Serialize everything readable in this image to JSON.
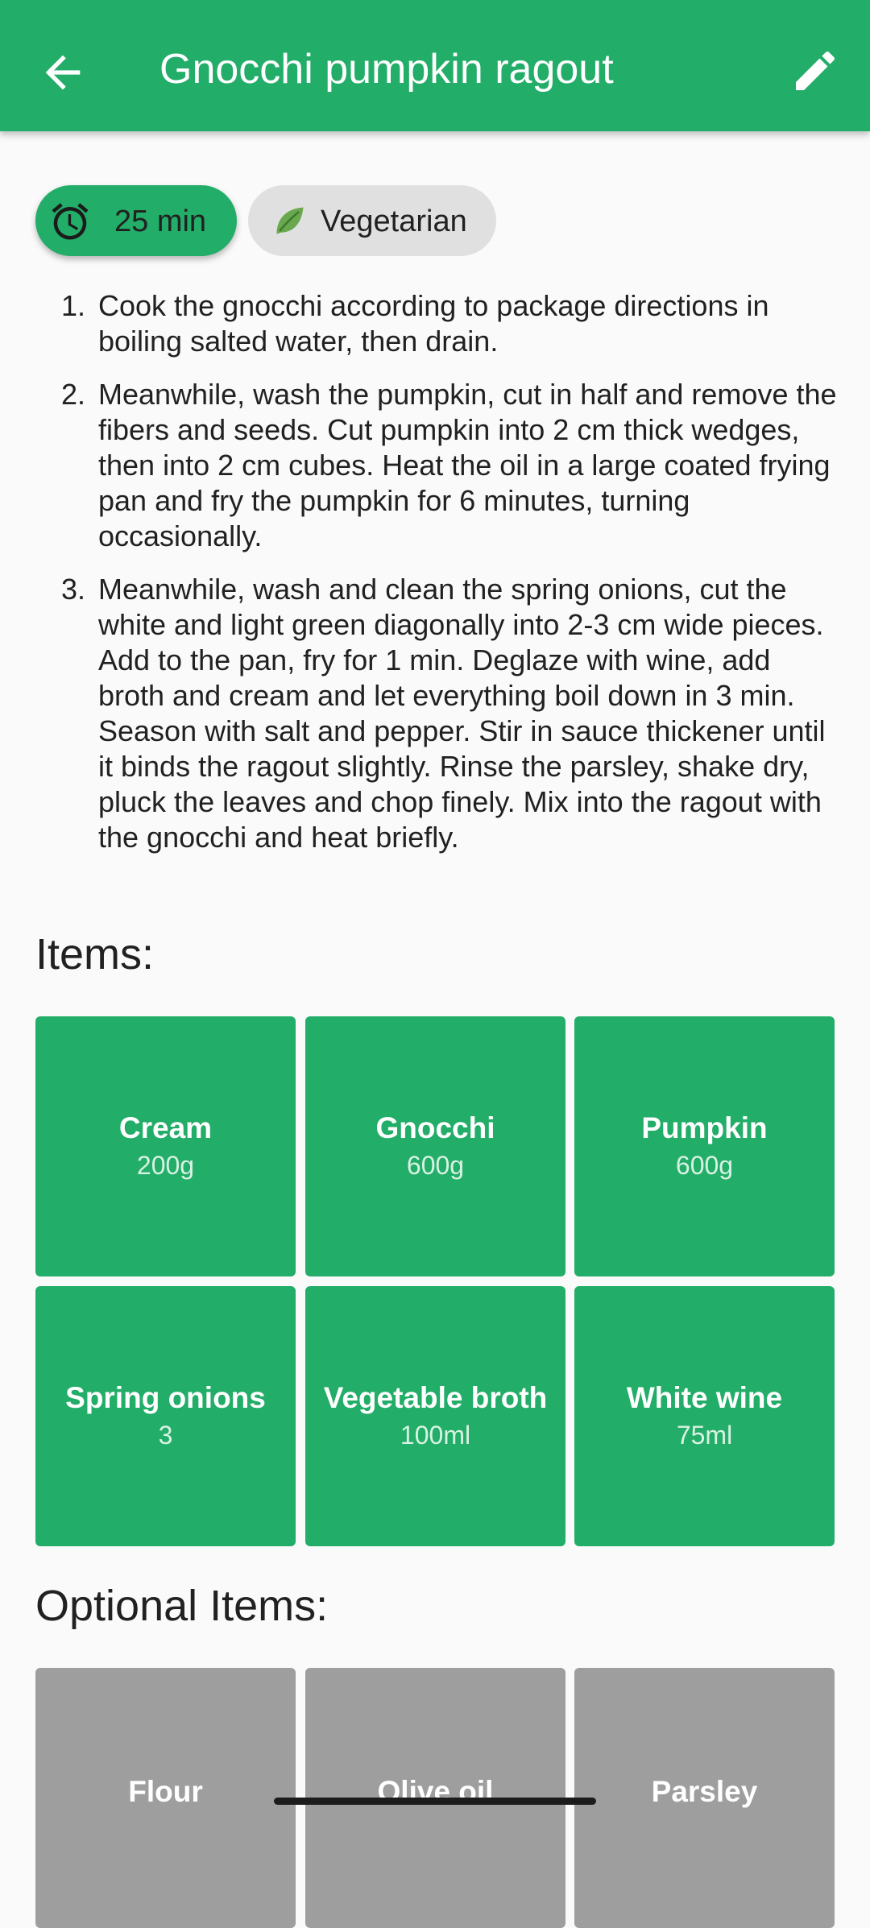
{
  "appbar": {
    "title": "Gnocchi pumpkin ragout",
    "back_icon": "arrow-back-icon",
    "edit_icon": "pencil-icon",
    "color": "#22ad68"
  },
  "chips": {
    "time": {
      "label": "25 min",
      "icon": "alarm-clock-icon"
    },
    "diet": {
      "label": "Vegetarian",
      "icon": "leaf-icon"
    }
  },
  "steps": [
    {
      "num": "1.",
      "text": "Cook the gnocchi according to package directions in boiling salted water, then drain."
    },
    {
      "num": "2.",
      "text": "Meanwhile, wash the pumpkin, cut in half and remove the fibers and seeds. Cut pumpkin into 2 cm thick wedges, then into 2 cm cubes. Heat the oil in a large coated frying pan and fry the pumpkin for 6 minutes, turning occasionally."
    },
    {
      "num": "3.",
      "text": "Meanwhile, wash and clean the spring onions, cut the white and light green diagonally into 2-3 cm wide pieces. Add to the pan, fry for 1 min. Deglaze with wine, add broth and cream and let everything boil down in 3 min. Season with salt and pepper. Stir in sauce thickener until it binds the ragout slightly. Rinse the parsley, shake dry, pluck the leaves and chop finely. Mix into the ragout with the gnocchi and heat briefly."
    }
  ],
  "items_title": "Items:",
  "items": [
    {
      "name": "Cream",
      "amount": "200g"
    },
    {
      "name": "Gnocchi",
      "amount": "600g"
    },
    {
      "name": "Pumpkin",
      "amount": "600g"
    },
    {
      "name": "Spring onions",
      "amount": "3"
    },
    {
      "name": "Vegetable broth",
      "amount": "100ml"
    },
    {
      "name": "White wine",
      "amount": "75ml"
    }
  ],
  "optional_title": "Optional Items:",
  "optional_items": [
    {
      "name": "Flour"
    },
    {
      "name": "Olive oil"
    },
    {
      "name": "Parsley"
    }
  ]
}
